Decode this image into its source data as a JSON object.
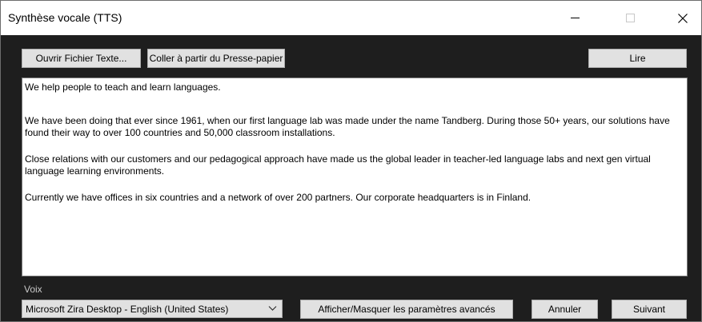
{
  "window": {
    "title": "Synthèse vocale (TTS)"
  },
  "toolbar": {
    "open_file_label": "Ouvrir Fichier Texte...",
    "paste_label": "Coller à partir du Presse-papier",
    "read_label": "Lire"
  },
  "text_content": {
    "paragraphs": [
      "We help people to teach and learn languages.",
      "We have been doing that ever since 1961, when our first language lab was made under the name Tandberg. During those 50+ years, our solutions have found their way to over 100 countries and 50,000 classroom installations.",
      "Close relations with our customers and our pedagogical approach have made us the global leader in teacher-led language labs and next gen virtual language learning environments.",
      "Currently we have offices in six countries and a network of over 200 partners. Our corporate headquarters is in Finland."
    ]
  },
  "voice": {
    "label": "Voix",
    "selected": "Microsoft Zira Desktop - English (United States)"
  },
  "footer": {
    "advanced_label": "Afficher/Masquer les paramètres avancés",
    "cancel_label": "Annuler",
    "next_label": "Suivant"
  },
  "colors": {
    "background": "#1e1e1e",
    "titlebar": "#ffffff",
    "button": "#e1e1e1"
  }
}
